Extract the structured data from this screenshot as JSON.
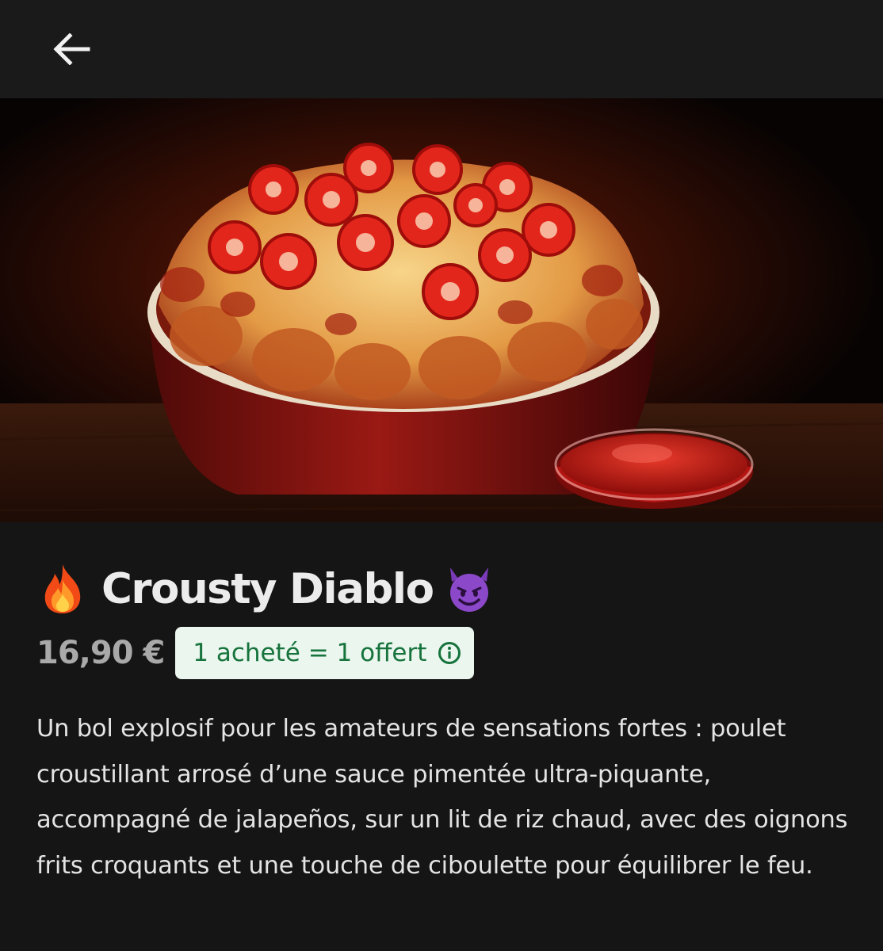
{
  "header": {
    "back_icon": "arrow-left-icon"
  },
  "hero": {
    "image_alt": "Bol de poulet croustillant nappé de fromage fondu et de rondelles de piment rouge, avec une coupelle de sauce",
    "icon": "food-photo"
  },
  "product": {
    "title_prefix_icon": "fire-emoji",
    "title": "Crousty Diablo",
    "title_suffix_icon": "smiling-devil-emoji",
    "price": "16,90 €",
    "promo_label": "1 acheté = 1 offert",
    "promo_icon": "info-icon",
    "description": "Un bol explosif pour les amateurs de sensations fortes : poulet croustillant arrosé d’une sauce pimentée ultra-piquante, accompagné de jalapeños, sur un lit de riz chaud, avec des oignons frits croquants et une touche de ciboulette pour équilibrer le feu."
  },
  "colors": {
    "background": "#151515",
    "header_background": "#1a1a1a",
    "promo_background": "#eaf6ee",
    "promo_text": "#17733c",
    "price_text": "#a9a9a9"
  }
}
